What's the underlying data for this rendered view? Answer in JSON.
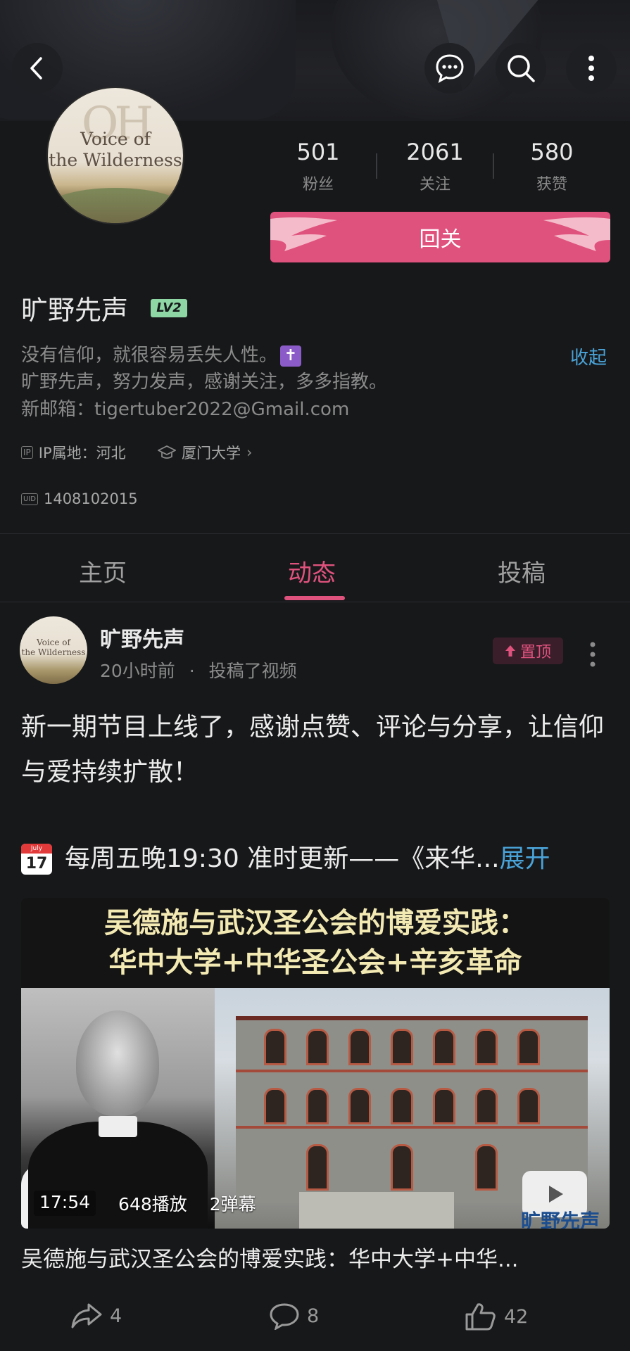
{
  "header": {
    "back_icon": "chevron-left-icon",
    "message_icon": "chat-bubble-icon",
    "search_icon": "search-icon",
    "more_icon": "more-vertical-icon"
  },
  "profile": {
    "avatar_text_line1": "Voice of",
    "avatar_text_line2": "the Wilderness",
    "stats": [
      {
        "value": "501",
        "label": "粉丝"
      },
      {
        "value": "2061",
        "label": "关注"
      },
      {
        "value": "580",
        "label": "获赞"
      }
    ],
    "follow_button": "回关",
    "name": "旷野先声",
    "level": "LV2",
    "bio_lines": [
      "没有信仰，就很容易丢失人性。",
      "旷野先声，努力发声，感谢关注，多多指教。",
      "新邮箱：tigertuber2022@Gmail.com"
    ],
    "bio_emoji": "✝",
    "collapse_label": "收起",
    "ip_badge": "IP",
    "ip_location": "IP属地：河北",
    "school": "厦门大学",
    "uid_badge": "UID",
    "uid": "1408102015"
  },
  "tabs": [
    {
      "label": "主页",
      "active": false
    },
    {
      "label": "动态",
      "active": true
    },
    {
      "label": "投稿",
      "active": false
    }
  ],
  "post": {
    "author": "旷野先声",
    "time": "20小时前",
    "dot": "·",
    "action": "投稿了视频",
    "pin_label": "置顶",
    "text": "新一期节目上线了，感谢点赞、评论与分享，让信仰与爱持续扩散！",
    "calendar_month": "July",
    "calendar_day": "17",
    "schedule_text": "每周五晚19:30 准时更新——《来华...",
    "expand_label": "展开",
    "video": {
      "title_line1": "吴德施与武汉圣公会的博爱实践：",
      "title_line2": "华中大学+中华圣公会+辛亥革命",
      "duration": "17:54",
      "plays": "648播放",
      "danmaku": "2弹幕",
      "watermark": "旷野先声"
    },
    "caption": "吴德施与武汉圣公会的博爱实践：华中大学+中华...",
    "shares": "4",
    "comments": "8",
    "likes": "42"
  }
}
